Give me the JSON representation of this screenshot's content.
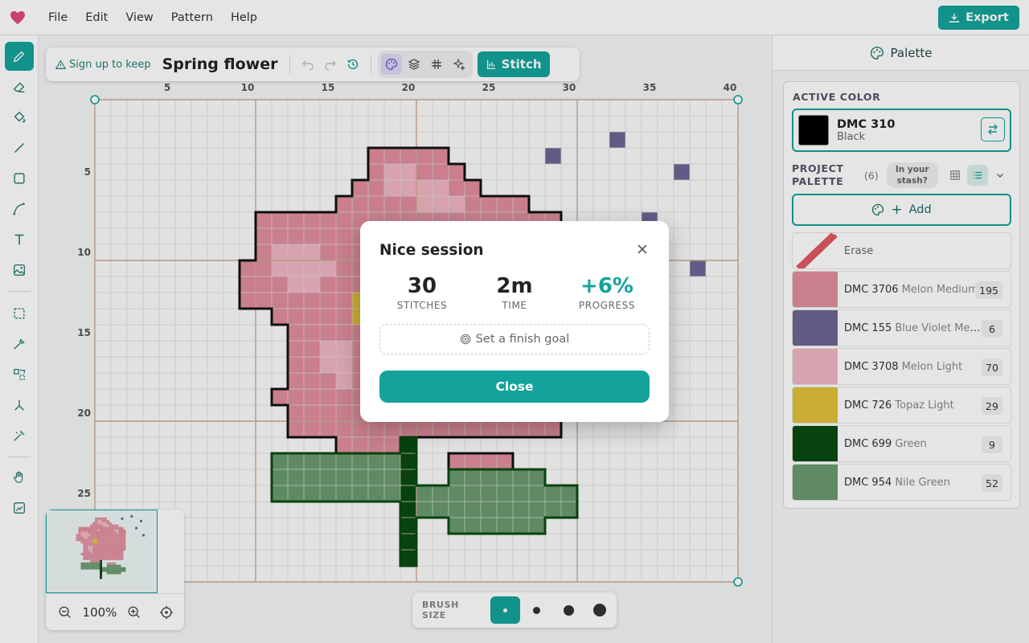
{
  "menu": {
    "items": [
      "File",
      "Edit",
      "View",
      "Pattern",
      "Help"
    ],
    "export_label": "Export"
  },
  "tools": [
    "pencil-icon",
    "eraser-icon",
    "fill-bucket-icon",
    "line-icon",
    "rectangle-icon",
    "curve-icon",
    "text-icon",
    "image-icon",
    "select-icon",
    "eyedropper-icon",
    "selection-tool-icon",
    "backstitch-icon",
    "magic-wand-icon",
    "hand-icon",
    "image-trace-icon"
  ],
  "toolbar": {
    "signup_label": "Sign up to keep",
    "pattern_title": "Spring flower",
    "stitch_label": "Stitch"
  },
  "grid": {
    "col_labels": [
      "5",
      "10",
      "15",
      "20",
      "25",
      "30",
      "35",
      "40"
    ],
    "row_labels": [
      "5",
      "10",
      "15",
      "20",
      "25"
    ]
  },
  "zoom": {
    "level": "100%"
  },
  "brush": {
    "label": "BRUSH SIZE",
    "sizes": [
      "1",
      "2",
      "3",
      "4"
    ],
    "selected": 0
  },
  "palette": {
    "header": "Palette",
    "active_label": "ACTIVE COLOR",
    "active_color": {
      "code": "DMC 310",
      "name": "Black",
      "hex": "#000000"
    },
    "project_label": "PROJECT PALETTE",
    "project_count": "(6)",
    "stash_label": "In your stash?",
    "add_label": "Add",
    "erase_label": "Erase",
    "colors": [
      {
        "code": "DMC 3706",
        "name": "Melon Medium",
        "count": "195",
        "hex": "#e08e9f"
      },
      {
        "code": "DMC 155",
        "name": "Blue Violet Medi...",
        "count": "6",
        "hex": "#6b6795"
      },
      {
        "code": "DMC 3708",
        "name": "Melon Light",
        "count": "70",
        "hex": "#f0b6c2"
      },
      {
        "code": "DMC 726",
        "name": "Topaz Light",
        "count": "29",
        "hex": "#e3c13a"
      },
      {
        "code": "DMC 699",
        "name": "Green",
        "count": "9",
        "hex": "#0a4a10"
      },
      {
        "code": "DMC 954",
        "name": "Nile Green",
        "count": "52",
        "hex": "#6a9a70"
      }
    ]
  },
  "modal": {
    "title": "Nice session",
    "stats": [
      {
        "value": "30",
        "label": "STITCHES"
      },
      {
        "value": "2m",
        "label": "TIME"
      },
      {
        "value": "+6%",
        "label": "PROGRESS"
      }
    ],
    "goal_label": "Set a finish goal",
    "close_label": "Close"
  },
  "colors": {
    "accent": "#13a39a",
    "grid_major": "#c9ab94",
    "outline": "#111111"
  }
}
